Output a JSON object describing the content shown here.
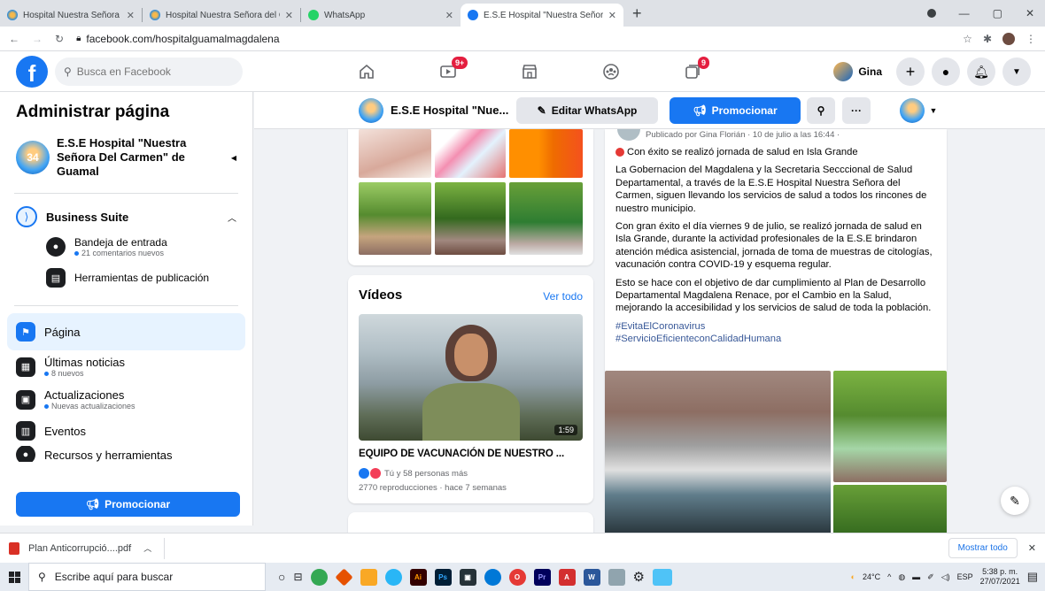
{
  "browser": {
    "tabs": [
      {
        "title": "Hospital Nuestra Señora del Carme",
        "favicon": "hospital-favicon",
        "active": false
      },
      {
        "title": "Hospital Nuestra Señora del Carme",
        "favicon": "hospital-favicon",
        "active": false
      },
      {
        "title": "WhatsApp",
        "favicon": "whatsapp-favicon",
        "active": false
      },
      {
        "title": "E.S.E Hospital \"Nuestra Señora D",
        "favicon": "facebook-favicon",
        "active": true
      }
    ],
    "url": "facebook.com/hospitalguamalmagdalena"
  },
  "fb_nav": {
    "search_placeholder": "Busca en Facebook",
    "watch_badge": "9+",
    "groups_badge": "9",
    "user_name": "Gina"
  },
  "sidebar": {
    "title": "Administrar página",
    "page_name": "E.S.E Hospital \"Nuestra Señora Del Carmen\" de Guamal",
    "page_avatar_text": "34",
    "business_suite": "Business Suite",
    "inbox": {
      "label": "Bandeja de entrada",
      "sub": "21 comentarios nuevos"
    },
    "publishing_tools": "Herramientas de publicación",
    "items": [
      {
        "label": "Página",
        "sub": ""
      },
      {
        "label": "Últimas noticias",
        "sub": "8 nuevos"
      },
      {
        "label": "Actualizaciones",
        "sub": "Nuevas actualizaciones"
      },
      {
        "label": "Eventos",
        "sub": ""
      },
      {
        "label": "Recursos y herramientas",
        "sub": ""
      }
    ],
    "promote": "Promocionar"
  },
  "page_bar": {
    "name": "E.S.E Hospital \"Nue...",
    "edit_whatsapp": "Editar WhatsApp",
    "promote": "Promocionar",
    "more": "···"
  },
  "videos": {
    "title": "Vídeos",
    "see_all": "Ver todo",
    "duration": "1:59",
    "video_title": "EQUIPO DE VACUNACIÓN DE NUESTRO ...",
    "reactions": "Tú y 58 personas más",
    "stats": "2770 reproducciones · hace 7 semanas"
  },
  "post": {
    "meta": "Publicado por Gina Florián · 10 de julio a las 16:44 ·",
    "headline": "Con éxito se realizó jornada de salud en Isla Grande",
    "p1": "La Gobernacion del Magdalena y la Secretaria Secccional de Salud Departamental, a través de la E.S.E Hospital Nuestra Señora del Carmen, siguen llevando los servicios de salud a todos los rincones de nuestro municipio.",
    "p2": "Con gran éxito el día viernes 9 de julio, se realizó jornada de salud en Isla Grande, durante la actividad profesionales de la E.S.E brindaron atención médica asistencial, jornada de toma de muestras de citologías, vacunación contra COVID-19 y esquema regular.",
    "p3": "Esto se hace con el objetivo de dar cumplimiento al Plan de Desarrollo Departamental Magdalena Renace, por el Cambio en la Salud, mejorando la accesibilidad y los servicios de salud de toda la población.",
    "hashtags": [
      "#EvitaElCoronavirus",
      "#ServicioEficienteconCalidadHumana"
    ]
  },
  "download": {
    "file": "Plan Anticorrupció....pdf",
    "show_all": "Mostrar todo"
  },
  "taskbar": {
    "search_placeholder": "Escribe aquí para buscar",
    "weather": "24°C",
    "lang": "ESP",
    "time": "5:38 p. m.",
    "date": "27/07/2021"
  },
  "colors": {
    "fb_blue": "#1877f2",
    "badge_red": "#e41e3f",
    "page_bg": "#f0f2f5"
  }
}
